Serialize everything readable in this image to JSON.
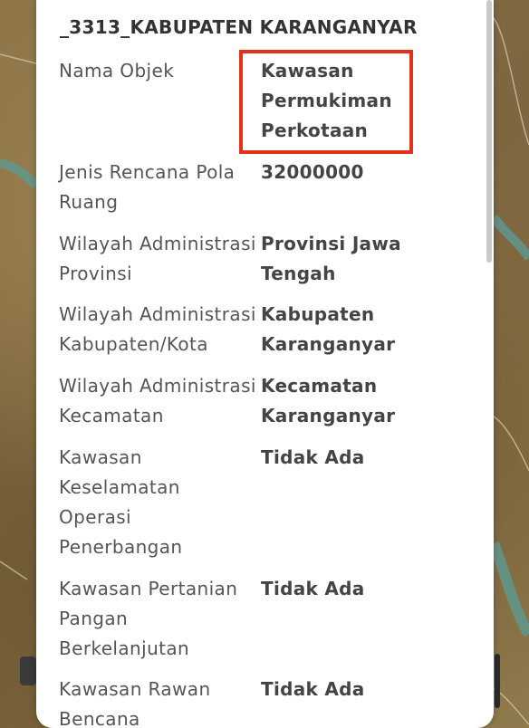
{
  "popup": {
    "title": "_3313_KABUPATEN KARANGANYAR",
    "highlight_color": "#e0321c",
    "rows": [
      {
        "label": "Nama Objek",
        "value": "Kawasan Permukiman Perkotaan"
      },
      {
        "label": "Jenis Rencana Pola Ruang",
        "value": "32000000"
      },
      {
        "label": "Wilayah Administrasi Provinsi",
        "value": "Provinsi Jawa Tengah"
      },
      {
        "label": "Wilayah Administrasi Kabupaten/Kota",
        "value": "Kabupaten Karanganyar"
      },
      {
        "label": "Wilayah Administrasi Kecamatan",
        "value": "Kecamatan Karanganyar"
      },
      {
        "label": "Kawasan Keselamatan Operasi Penerbangan",
        "value": "Tidak Ada"
      },
      {
        "label": "Kawasan Pertanian Pangan Berkelanjutan",
        "value": "Tidak Ada"
      },
      {
        "label": "Kawasan Rawan Bencana",
        "value": "Tidak Ada"
      }
    ]
  }
}
